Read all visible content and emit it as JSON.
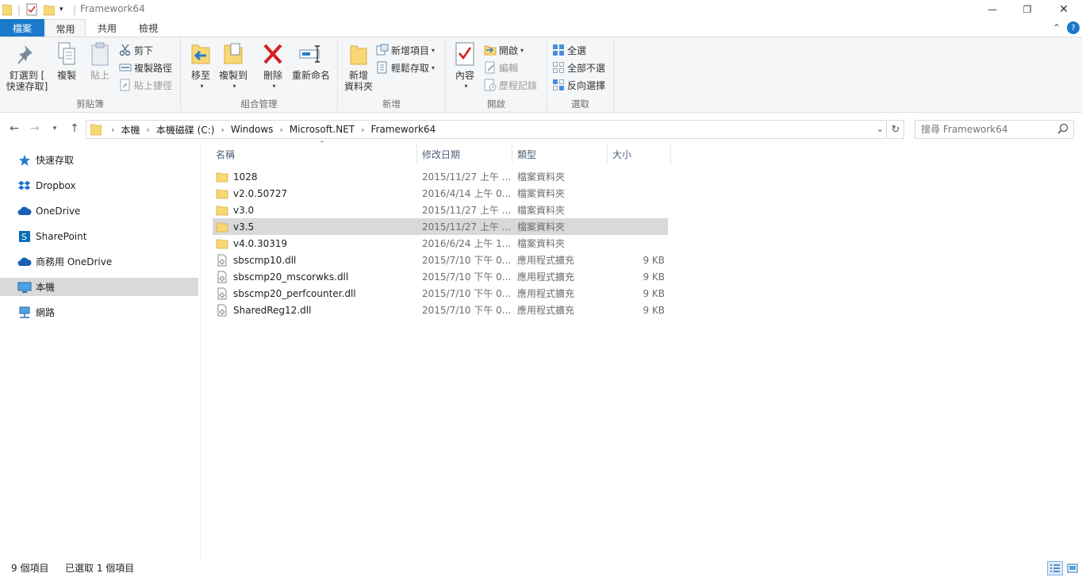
{
  "window": {
    "title": "Framework64",
    "minimize": "—",
    "restore": "❐",
    "close": "✕"
  },
  "ribbon_tabs": {
    "file": "檔案",
    "home": "常用",
    "share": "共用",
    "view": "檢視",
    "collapse": "⌃",
    "help": "?"
  },
  "ribbon": {
    "clipboard": {
      "label": "剪貼簿",
      "pin_line1": "釘選到 [",
      "pin_line2": "快速存取]",
      "copy": "複製",
      "paste": "貼上",
      "cut": "剪下",
      "copy_path": "複製路徑",
      "paste_shortcut": "貼上捷徑"
    },
    "organize": {
      "label": "組合管理",
      "move_to": "移至",
      "copy_to": "複製到",
      "delete": "刪除",
      "rename": "重新命名"
    },
    "new": {
      "label": "新增",
      "new_folder_line1": "新增",
      "new_folder_line2": "資料夾",
      "new_item": "新增項目",
      "easy_access": "輕鬆存取"
    },
    "open": {
      "label": "開啟",
      "properties": "內容",
      "open": "開啟",
      "edit": "編輯",
      "history": "歷程記錄"
    },
    "select": {
      "label": "選取",
      "select_all": "全選",
      "select_none": "全部不選",
      "invert": "反向選擇"
    }
  },
  "address": {
    "breadcrumbs": [
      "本機",
      "本機磁碟 (C:)",
      "Windows",
      "Microsoft.NET",
      "Framework64"
    ],
    "search_placeholder": "搜尋 Framework64"
  },
  "nav_pane": {
    "items": [
      {
        "label": "快速存取",
        "icon": "star-icon"
      },
      {
        "label": "Dropbox",
        "icon": "dropbox-icon"
      },
      {
        "label": "OneDrive",
        "icon": "cloud-icon"
      },
      {
        "label": "SharePoint",
        "icon": "sharepoint-icon"
      },
      {
        "label": "商務用 OneDrive",
        "icon": "cloud-icon"
      },
      {
        "label": "本機",
        "icon": "computer-icon",
        "selected": true
      },
      {
        "label": "網路",
        "icon": "network-icon"
      }
    ]
  },
  "file_list": {
    "columns": [
      "名稱",
      "修改日期",
      "類型",
      "大小"
    ],
    "rows": [
      {
        "name": "1028",
        "date": "2015/11/27 上午 ...",
        "type": "檔案資料夾",
        "size": "",
        "kind": "folder"
      },
      {
        "name": "v2.0.50727",
        "date": "2016/4/14 上午 0...",
        "type": "檔案資料夾",
        "size": "",
        "kind": "folder"
      },
      {
        "name": "v3.0",
        "date": "2015/11/27 上午 ...",
        "type": "檔案資料夾",
        "size": "",
        "kind": "folder"
      },
      {
        "name": "v3.5",
        "date": "2015/11/27 上午 ...",
        "type": "檔案資料夾",
        "size": "",
        "kind": "folder",
        "selected": true
      },
      {
        "name": "v4.0.30319",
        "date": "2016/6/24 上午 1...",
        "type": "檔案資料夾",
        "size": "",
        "kind": "folder"
      },
      {
        "name": "sbscmp10.dll",
        "date": "2015/7/10 下午 0...",
        "type": "應用程式擴充",
        "size": "9 KB",
        "kind": "dll"
      },
      {
        "name": "sbscmp20_mscorwks.dll",
        "date": "2015/7/10 下午 0...",
        "type": "應用程式擴充",
        "size": "9 KB",
        "kind": "dll"
      },
      {
        "name": "sbscmp20_perfcounter.dll",
        "date": "2015/7/10 下午 0...",
        "type": "應用程式擴充",
        "size": "9 KB",
        "kind": "dll"
      },
      {
        "name": "SharedReg12.dll",
        "date": "2015/7/10 下午 0...",
        "type": "應用程式擴充",
        "size": "9 KB",
        "kind": "dll"
      }
    ]
  },
  "status": {
    "item_count": "9 個項目",
    "selected_count": "已選取 1 個項目"
  },
  "colors": {
    "accent": "#1979ca",
    "folder": "#f8d775",
    "selection": "#d9d9d9"
  }
}
